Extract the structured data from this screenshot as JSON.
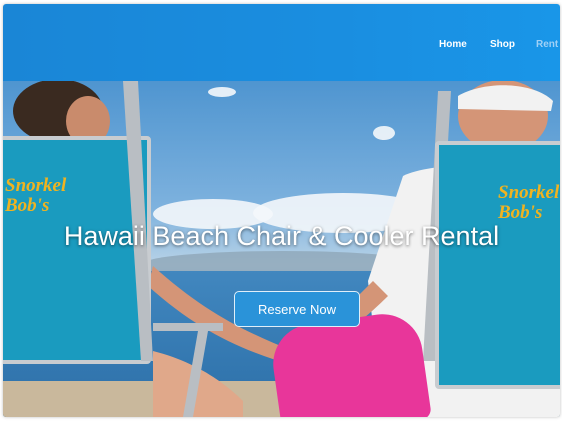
{
  "nav": {
    "items": [
      {
        "label": "Home"
      },
      {
        "label": "Shop"
      },
      {
        "label": "Rent"
      }
    ]
  },
  "hero": {
    "title": "Hawaii Beach Chair & Cooler Rental",
    "cta_label": "Reserve Now",
    "chair_text": "Snorkel Bob's"
  },
  "colors": {
    "header": "#1a8ee0",
    "button": "#2a93d9",
    "chair": "#1a9bbf",
    "chair_text": "#f0b320"
  }
}
